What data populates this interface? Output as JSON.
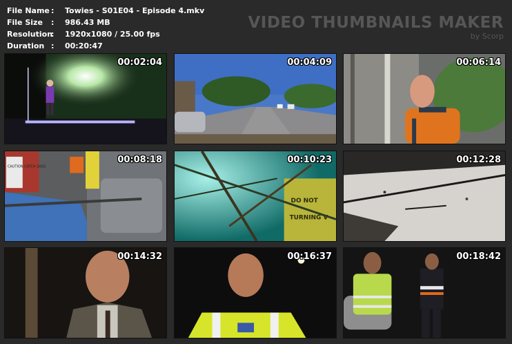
{
  "file_info": {
    "rows": [
      {
        "label": "File Name",
        "sep": ":",
        "value": "Towies - S01E04 - Episode 4.mkv"
      },
      {
        "label": "File Size",
        "sep": ":",
        "value": "986.43 MB"
      },
      {
        "label": "Resolution",
        "sep": ":",
        "value": "1920x1080 / 25.00 fps"
      },
      {
        "label": "Duration",
        "sep": ":",
        "value": "00:20:47"
      }
    ]
  },
  "brand": {
    "title": "VIDEO THUMBNAILS MAKER",
    "subtitle": "by Scorp"
  },
  "thumbnails": [
    {
      "timestamp": "00:02:04"
    },
    {
      "timestamp": "00:04:09"
    },
    {
      "timestamp": "00:06:14"
    },
    {
      "timestamp": "00:08:18"
    },
    {
      "timestamp": "00:10:23"
    },
    {
      "timestamp": "00:12:28"
    },
    {
      "timestamp": "00:14:32"
    },
    {
      "timestamp": "00:16:37"
    },
    {
      "timestamp": "00:18:42"
    }
  ],
  "scene_text": {
    "sign_caution": "CAUTION CATCH SAGS",
    "sign_do_not": "DO NOT",
    "sign_turning": "TURNING V"
  }
}
